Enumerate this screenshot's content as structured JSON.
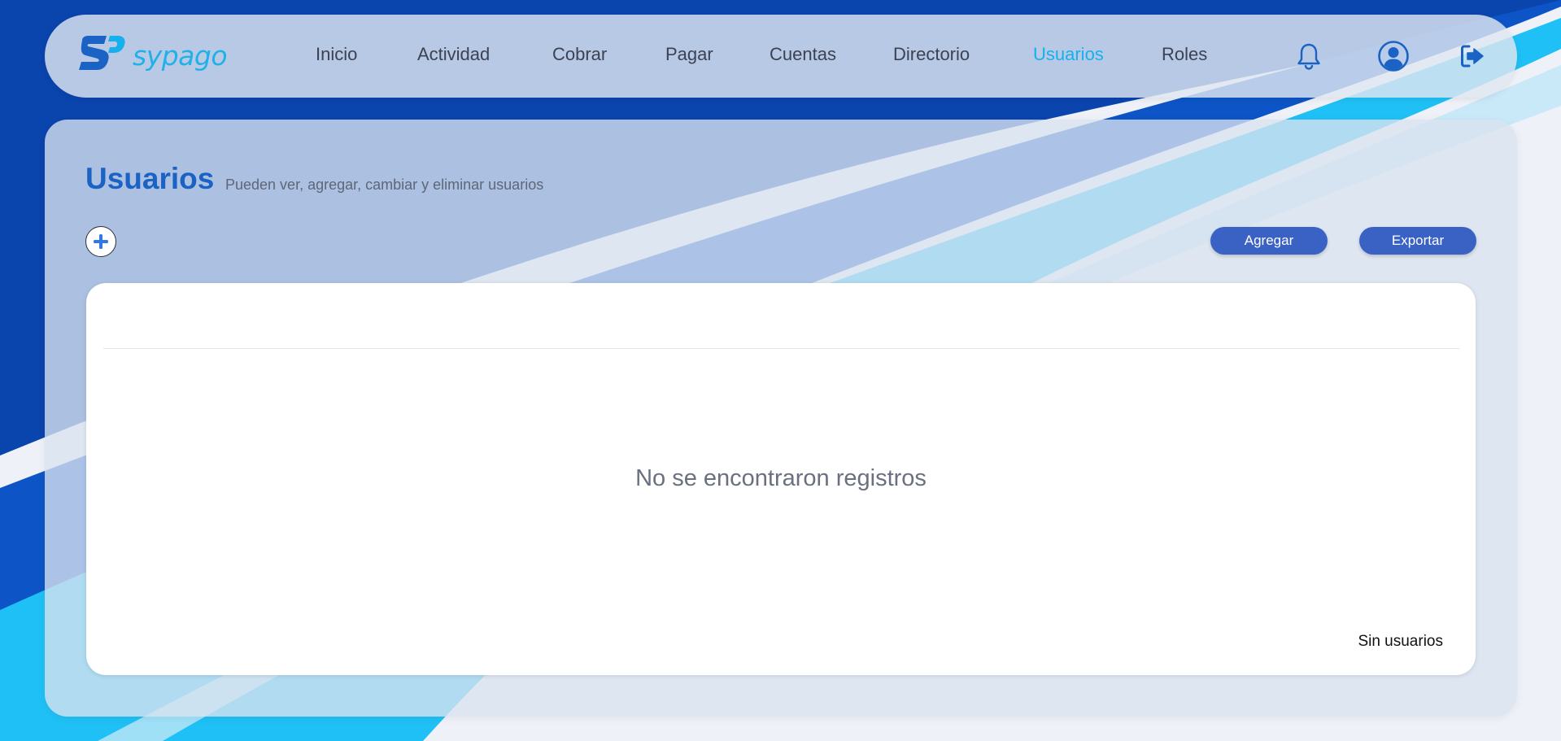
{
  "brand": {
    "name": "sypago",
    "primary_color": "#1a62c4",
    "accent_color": "#16b0ec"
  },
  "nav": {
    "items": [
      {
        "label": "Inicio"
      },
      {
        "label": "Actividad"
      },
      {
        "label": "Cobrar"
      },
      {
        "label": "Pagar"
      },
      {
        "label": "Cuentas"
      },
      {
        "label": "Directorio"
      },
      {
        "label": "Usuarios",
        "active": true
      },
      {
        "label": "Roles"
      }
    ],
    "icons": [
      "bell-icon",
      "user-circle-icon",
      "logout-icon"
    ]
  },
  "page": {
    "title": "Usuarios",
    "subtitle": "Pueden ver, agregar, cambiar y eliminar usuarios"
  },
  "actions": {
    "add_icon": "plus-circle-icon",
    "add_label": "Agregar",
    "export_label": "Exportar"
  },
  "table": {
    "empty_message": "No se encontraron registros",
    "footer_text": "Sin usuarios"
  }
}
